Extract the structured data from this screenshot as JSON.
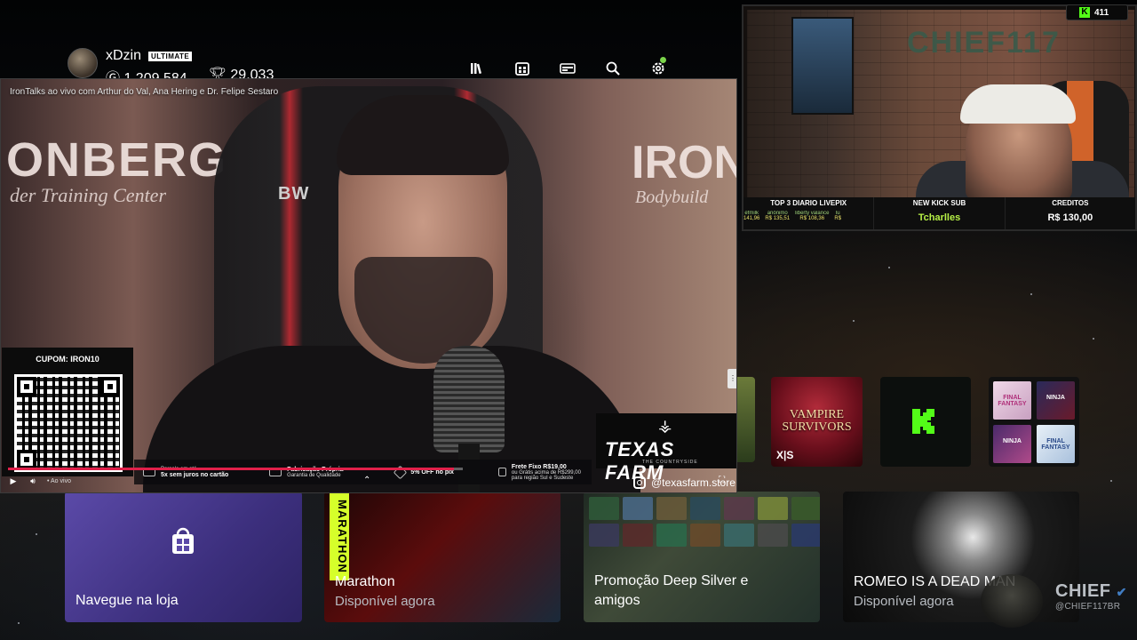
{
  "profile": {
    "gamertag": "xDzin",
    "badge": "ULTIMATE",
    "gamerscore": "1.209.584",
    "achievements": "29.033"
  },
  "topnav": {
    "icons": [
      "library-icon",
      "store-icon",
      "game-pass-icon",
      "search-icon",
      "settings-icon"
    ]
  },
  "video": {
    "title": "IronTalks ao vivo com Arthur do Val, Ana Hering e Dr. Felipe Sestaro",
    "sign_left": "ONBERG",
    "sign_left_sub": "der Training Center",
    "sign_right": "IRON",
    "sign_right_sub": "Bodybuild",
    "chair_logo": "BW",
    "coupon_label": "CUPOM: IRON10",
    "sponsor_name": "TEXAS FARM",
    "sponsor_sub": "THE COUNTRYSIDE",
    "instagram_handle": "@texasfarm.store",
    "live_label": "• Ao vivo",
    "progress": 0.98,
    "promos": [
      {
        "line1": "Parcele em até",
        "line2": "5x sem juros no cartão"
      },
      {
        "line1": "Fabricação Própria",
        "line2": "Garantia de Qualidade"
      },
      {
        "line1": "5% OFF no pix",
        "line2": ""
      },
      {
        "line1": "Frete Fixo R$19,00",
        "line2": "ou Grátis acima de R$299,00 para região Sul e Sudeste"
      }
    ]
  },
  "cam": {
    "brand": "CHIEF117",
    "viewers": "411",
    "footer": {
      "top3_label": "TOP 3 DIARIO LIVEPIX",
      "donors": [
        {
          "name": "efmilk",
          "amount": "141,96"
        },
        {
          "name": "anônimo",
          "amount": "R$ 135,51"
        },
        {
          "name": "liberty valance",
          "amount": "R$ 108,36"
        },
        {
          "name": "lu",
          "amount": "R$"
        }
      ],
      "sub_label": "NEW KICK SUB",
      "sub_name": "Tcharlles",
      "credits_label": "CREDITOS",
      "credits_value": "R$ 130,00"
    }
  },
  "tiles_row1": {
    "vampire_title": "VAMPIRE SURVIVORS",
    "vampire_platform": "X|S",
    "collection_labels": [
      "FINAL FANTASY",
      "NINJA",
      "NINJA",
      "FINAL FANTASY"
    ]
  },
  "tiles_row2": {
    "store_title": "Navegue na loja",
    "marathon_title": "Marathon",
    "marathon_sub": "Disponível agora",
    "marathon_vertical": "MARATHON",
    "deep_title": "Promoção Deep Silver e amigos",
    "romeo_title": "ROMEO IS A DEAD MAN",
    "romeo_sub": "Disponível agora"
  },
  "watermark": {
    "name": "CHIEF",
    "handle": "@CHIEF117BR"
  },
  "colors": {
    "accent_green": "#53fc18",
    "progress_red": "#e0204a",
    "store_purple": "#5b4aa8"
  }
}
